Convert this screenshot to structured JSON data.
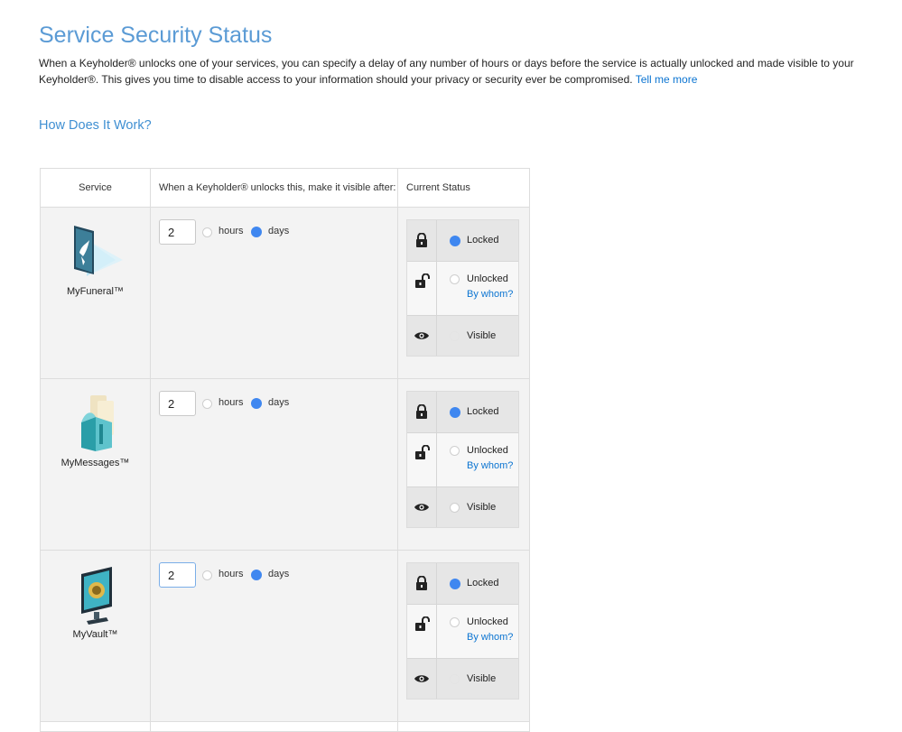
{
  "page": {
    "title": "Service Security Status",
    "intro_text": "When a Keyholder® unlocks one of your services, you can specify a delay of any number of hours or days before the service is actually unlocked and made visible to your Keyholder®.  This gives you time to disable access to your information should your privacy or security ever be compromised. ",
    "tell_me_more": "Tell me more",
    "how_title": "How Does It Work?"
  },
  "table": {
    "headers": {
      "service": "Service",
      "delay": "When a Keyholder® unlocks this, make it visible after:",
      "status": "Current Status"
    }
  },
  "labels": {
    "hours": "hours",
    "days": "days",
    "locked": "Locked",
    "unlocked": "Unlocked",
    "by_whom": "By whom?",
    "visible": "Visible"
  },
  "services": [
    {
      "name": "MyFuneral™",
      "icon": "myfuneral-icon",
      "delay_value": "2",
      "unit": "days",
      "status": "Locked"
    },
    {
      "name": "MyMessages™",
      "icon": "mymessages-icon",
      "delay_value": "2",
      "unit": "days",
      "status": "Locked"
    },
    {
      "name": "MyVault™",
      "icon": "myvault-icon",
      "delay_value": "2",
      "unit": "days",
      "status": "Locked"
    }
  ],
  "colors": {
    "title": "#5b9bd5",
    "link": "#0b74d1",
    "radio_selected": "#3f87f0",
    "row_background": "#f3f3f3"
  }
}
